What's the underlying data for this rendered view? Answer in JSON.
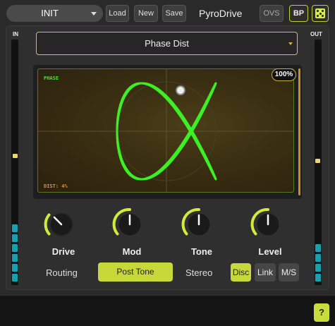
{
  "header": {
    "preset": "INIT",
    "load_label": "Load",
    "new_label": "New",
    "save_label": "Save",
    "title": "PyroDrive",
    "ovs_label": "OVS",
    "bp_label": "BP",
    "random_icon": "dice-icon"
  },
  "meters": {
    "in_label": "IN",
    "out_label": "OUT",
    "color": "#18a0ae"
  },
  "algorithm": {
    "selected": "Phase Dist"
  },
  "scope": {
    "title": "PHASE",
    "dist_readout": "DIST: 4%",
    "mix_badge": "100%",
    "trace_color": "#3cf024"
  },
  "knobs": [
    {
      "label": "Drive"
    },
    {
      "label": "Mod"
    },
    {
      "label": "Tone"
    },
    {
      "label": "Level"
    }
  ],
  "routing": {
    "label": "Routing",
    "post_tone_label": "Post Tone",
    "stereo_label": "Stereo",
    "modes": [
      "Disc",
      "Link",
      "M/S"
    ],
    "active_mode": "Disc"
  },
  "footer": {
    "help_label": "?"
  },
  "colors": {
    "accent": "#c6d83a",
    "panel": "#2f2f2f",
    "scope_border": "#557a1c"
  }
}
